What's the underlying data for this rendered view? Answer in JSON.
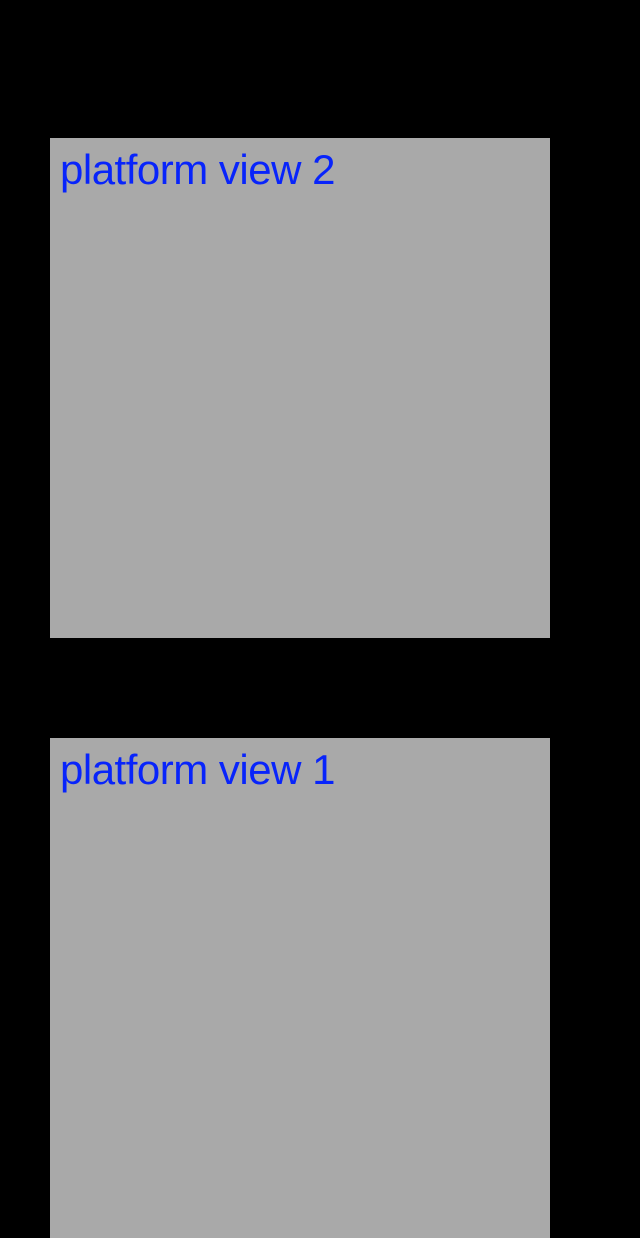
{
  "views": {
    "top": {
      "label": "platform view 2"
    },
    "bottom": {
      "label": "platform view 1"
    }
  },
  "colors": {
    "background": "#000000",
    "viewBackground": "#a9a9a9",
    "labelColor": "#0824fb"
  }
}
